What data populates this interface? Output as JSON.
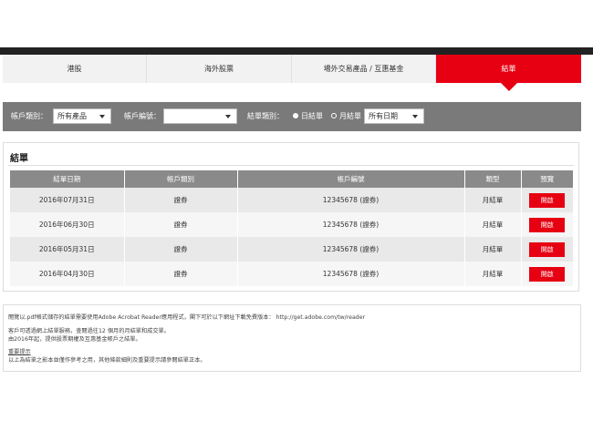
{
  "tabs": [
    {
      "label": "港股",
      "active": false
    },
    {
      "label": "海外股票",
      "active": false
    },
    {
      "label": "場外交易產品 / 互惠基金",
      "active": false
    },
    {
      "label": "結單",
      "active": true
    }
  ],
  "filters": {
    "account_type_label": "帳戶類別：",
    "account_type_value": "所有產品",
    "account_number_label": "帳戶編號：",
    "account_number_value": "",
    "statement_type_label": "結單類別：",
    "daily_label": "日結單",
    "monthly_label": "月結單",
    "selected_type": "daily",
    "date_value": "所有日期"
  },
  "panel": {
    "title": "結單",
    "columns": [
      "結單日期",
      "帳戶類別",
      "帳戶編號",
      "類型",
      "預覽"
    ],
    "rows": [
      {
        "date": "2016年07月31日",
        "account_type": "證券",
        "account_no": "12345678 (證券)",
        "type": "月結單",
        "action": "開啟"
      },
      {
        "date": "2016年06月30日",
        "account_type": "證券",
        "account_no": "12345678 (證券)",
        "type": "月結單",
        "action": "開啟"
      },
      {
        "date": "2016年05月31日",
        "account_type": "證券",
        "account_no": "12345678 (證券)",
        "type": "月結單",
        "action": "開啟"
      },
      {
        "date": "2016年04月30日",
        "account_type": "證券",
        "account_no": "12345678 (證券)",
        "type": "月結單",
        "action": "開啟"
      }
    ]
  },
  "notes": {
    "line1": "閱覽以.pdf格式儲存的結單需要使用Adobe Acrobat Reader應用程式，閣下可於以下網址下載免費版本：  http://get.adobe.com/tw/reader",
    "line2": "客戶可透過網上結單服務，查閱過往12 個月的月結單和成交單。",
    "line3": "由2016年起，提供股票期權及互惠基金帳戶之結單。",
    "link": "重要提示",
    "line4": "以上為結單之影本並僅作參考之用，其他條款細則及重要提示請參閱結單正本。"
  }
}
